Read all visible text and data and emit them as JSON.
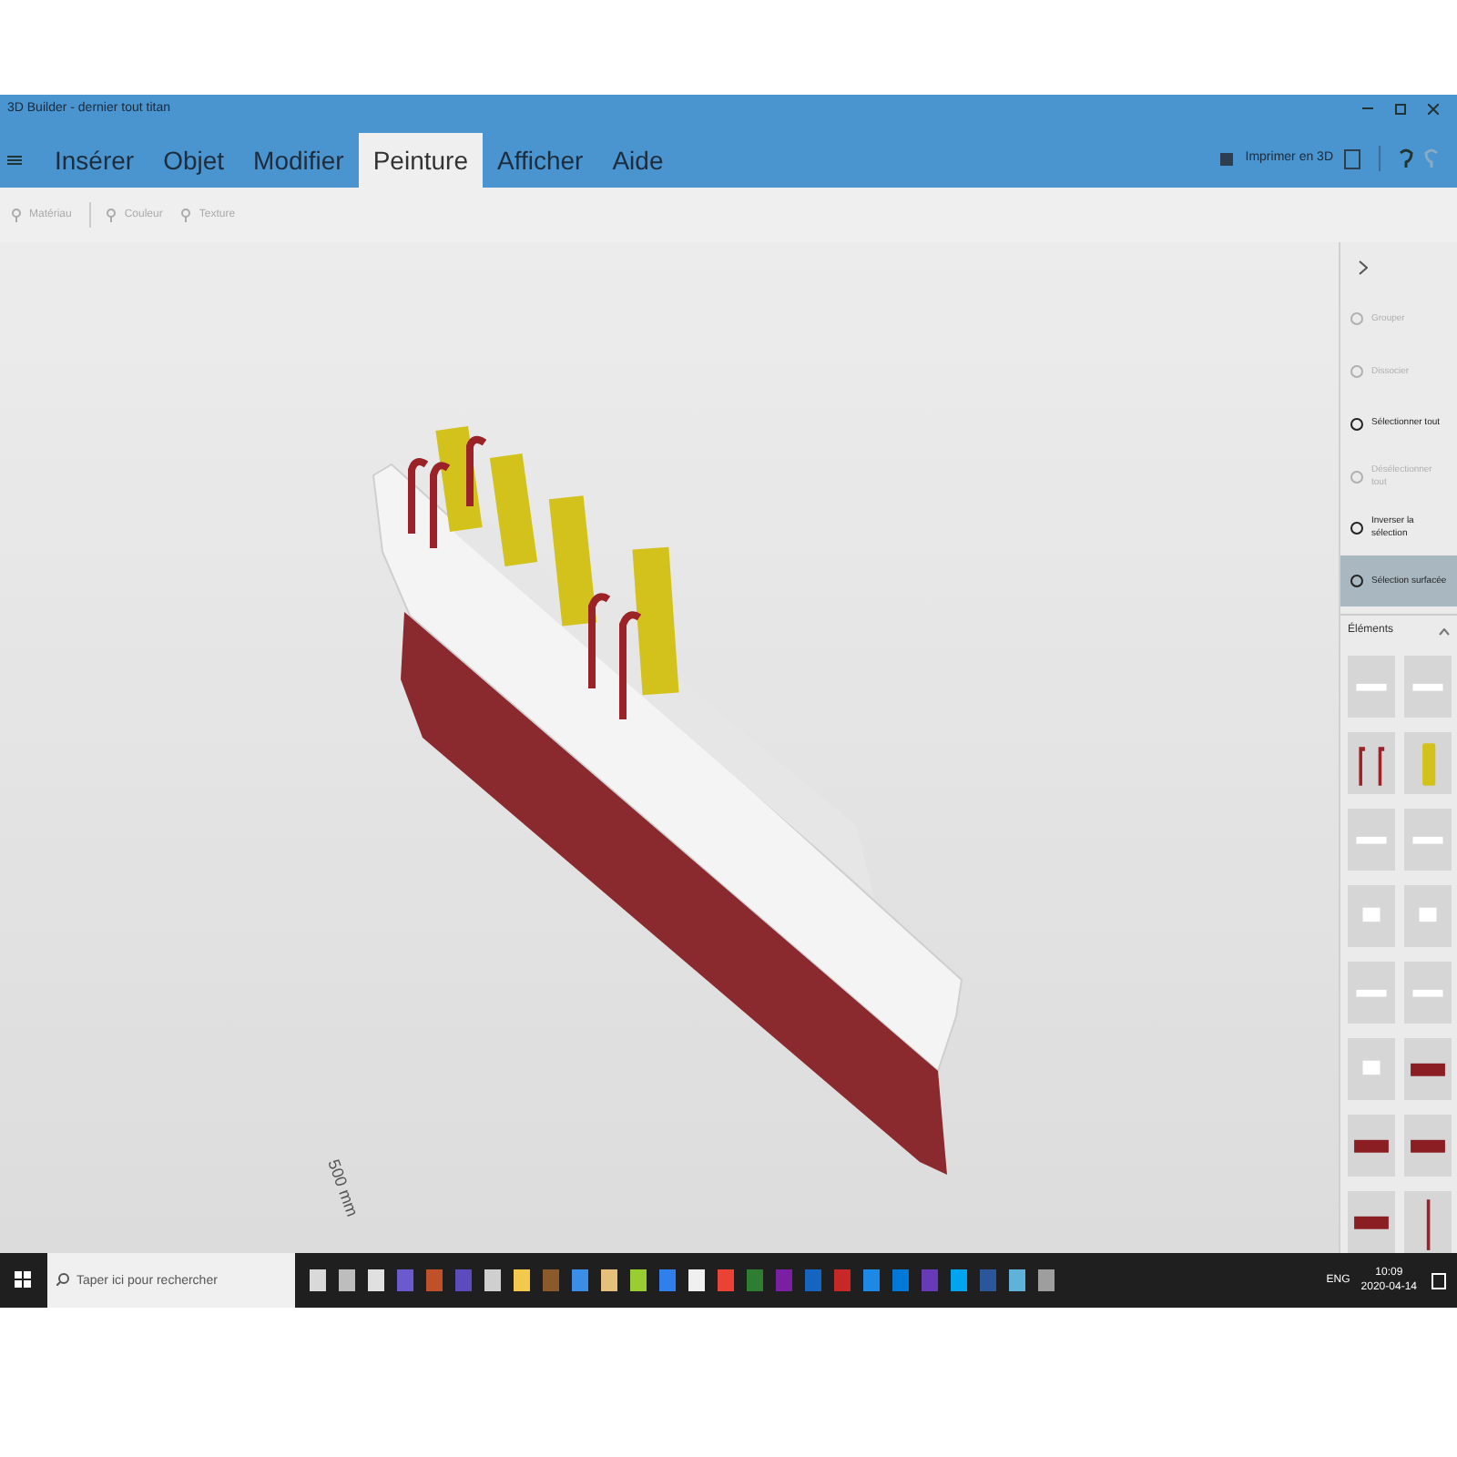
{
  "window": {
    "title": "3D Builder - dernier tout titan"
  },
  "tabs": [
    {
      "label": "Insérer",
      "selected": false
    },
    {
      "label": "Objet",
      "selected": false
    },
    {
      "label": "Modifier",
      "selected": false
    },
    {
      "label": "Peinture",
      "selected": true
    },
    {
      "label": "Afficher",
      "selected": false
    },
    {
      "label": "Aide",
      "selected": false
    }
  ],
  "header_actions": {
    "print_label": "Imprimer en 3D"
  },
  "toolbar": [
    {
      "label": "Matériau",
      "disabled": true
    },
    {
      "label": "Couleur",
      "disabled": true
    },
    {
      "label": "Texture",
      "disabled": true
    }
  ],
  "viewport": {
    "axis_labels": [
      "500 mm"
    ]
  },
  "side_panel": {
    "actions": [
      {
        "label": "Grouper",
        "disabled": true,
        "selected": false
      },
      {
        "label": "Dissocier",
        "disabled": true,
        "selected": false
      },
      {
        "label": "Sélectionner tout",
        "disabled": false,
        "selected": false
      },
      {
        "label": "Désélectionner tout",
        "disabled": true,
        "selected": false
      },
      {
        "label": "Inverser la sélection",
        "disabled": false,
        "selected": false
      },
      {
        "label": "Sélection surfacée",
        "disabled": false,
        "selected": true
      }
    ],
    "elements_title": "Éléments",
    "elements": [
      {
        "kind": "deck"
      },
      {
        "kind": "deck"
      },
      {
        "kind": "davits"
      },
      {
        "kind": "funnel"
      },
      {
        "kind": "deck"
      },
      {
        "kind": "deck"
      },
      {
        "kind": "piece"
      },
      {
        "kind": "piece"
      },
      {
        "kind": "deck"
      },
      {
        "kind": "deck"
      },
      {
        "kind": "piece"
      },
      {
        "kind": "hull"
      },
      {
        "kind": "hull"
      },
      {
        "kind": "hull"
      },
      {
        "kind": "hull"
      },
      {
        "kind": "mast"
      }
    ]
  },
  "taskbar": {
    "search_placeholder": "Taper ici pour rechercher",
    "apps": [
      {
        "color": "#d9d9d9"
      },
      {
        "color": "#bdbdbd"
      },
      {
        "color": "#e0e0e0"
      },
      {
        "color": "#6a5acd"
      },
      {
        "color": "#c0502a"
      },
      {
        "color": "#5b4bbd"
      },
      {
        "color": "#cfcfcf"
      },
      {
        "color": "#f2c94c"
      },
      {
        "color": "#8b5a2b"
      },
      {
        "color": "#3a8ee6"
      },
      {
        "color": "#e5c07b"
      },
      {
        "color": "#9acd32"
      },
      {
        "color": "#2f80ed"
      },
      {
        "color": "#f0f0f0"
      },
      {
        "color": "#ea4335"
      },
      {
        "color": "#2e7d32"
      },
      {
        "color": "#7b1fa2"
      },
      {
        "color": "#1565c0"
      },
      {
        "color": "#c62828"
      },
      {
        "color": "#1e88e5"
      },
      {
        "color": "#0078d7"
      },
      {
        "color": "#673ab7"
      },
      {
        "color": "#00a4ef"
      },
      {
        "color": "#2b579a"
      },
      {
        "color": "#5fb3d8"
      },
      {
        "color": "#9e9e9e"
      }
    ],
    "language": "ENG",
    "time": "10:09",
    "date": "2020-04-14"
  }
}
